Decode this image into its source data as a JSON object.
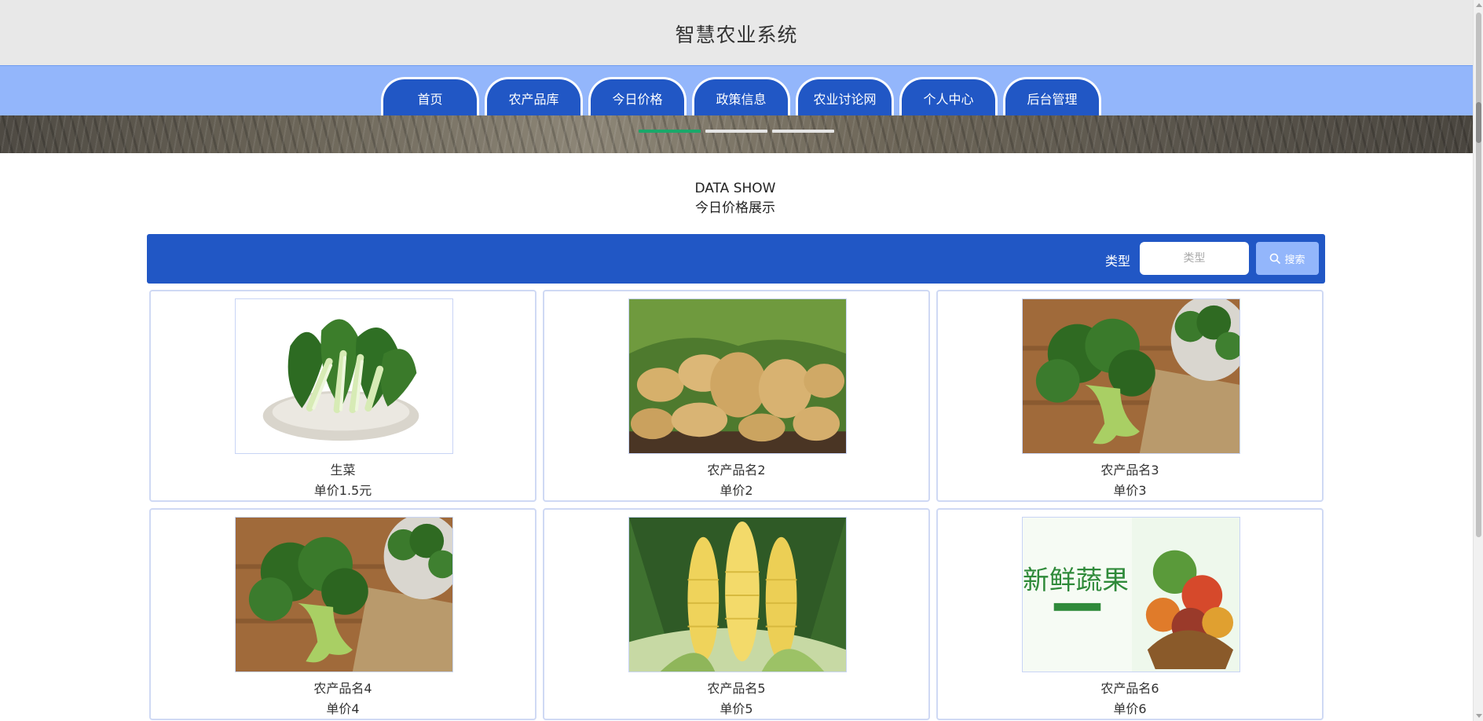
{
  "header": {
    "title": "智慧农业系统"
  },
  "nav": {
    "items": [
      {
        "label": "首页"
      },
      {
        "label": "农产品库"
      },
      {
        "label": "今日价格"
      },
      {
        "label": "政策信息"
      },
      {
        "label": "农业讨论网"
      },
      {
        "label": "个人中心"
      },
      {
        "label": "后台管理"
      }
    ]
  },
  "banner": {
    "slide_count": 3,
    "active_index": 0,
    "active_color": "#1aa86a"
  },
  "section": {
    "title_en": "DATA SHOW",
    "title_cn": "今日价格展示"
  },
  "search": {
    "label": "类型",
    "placeholder": "类型",
    "button_label": "搜索",
    "bar_color": "#2157c5",
    "button_color": "#93b6fb"
  },
  "products": [
    {
      "name": "生菜",
      "price": "单价1.5元",
      "image": "bok-choy-image"
    },
    {
      "name": "农产品名2",
      "price": "单价2",
      "image": "potatoes-image"
    },
    {
      "name": "农产品名3",
      "price": "单价3",
      "image": "broccoli-image"
    },
    {
      "name": "农产品名4",
      "price": "单价4",
      "image": "broccoli-image"
    },
    {
      "name": "农产品名5",
      "price": "单价5",
      "image": "corn-image"
    },
    {
      "name": "农产品名6",
      "price": "单价6",
      "image": "fresh-produce-banner-image",
      "image_text": "新鲜蔬果"
    }
  ],
  "colors": {
    "nav_bg": "#93b6fb",
    "nav_tab": "#2157c5",
    "header_bg": "#e8e8e8"
  }
}
